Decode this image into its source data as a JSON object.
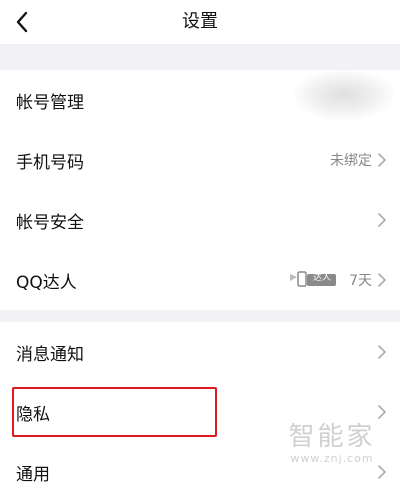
{
  "header": {
    "title": "设置"
  },
  "rows": [
    {
      "label": "帐号管理",
      "value": ""
    },
    {
      "label": "手机号码",
      "value": "未绑定"
    },
    {
      "label": "帐号安全",
      "value": ""
    },
    {
      "label": "QQ达人",
      "badge": "达人",
      "value": "7天"
    },
    {
      "label": "消息通知",
      "value": ""
    },
    {
      "label": "隐私",
      "value": ""
    },
    {
      "label": "通用",
      "value": ""
    }
  ],
  "watermark": {
    "brand": "智能家",
    "url": "www.znj.com"
  },
  "colors": {
    "background": "#f2f2f6",
    "row": "#ffffff",
    "highlight": "#e0191e",
    "secondary_text": "#888888"
  }
}
